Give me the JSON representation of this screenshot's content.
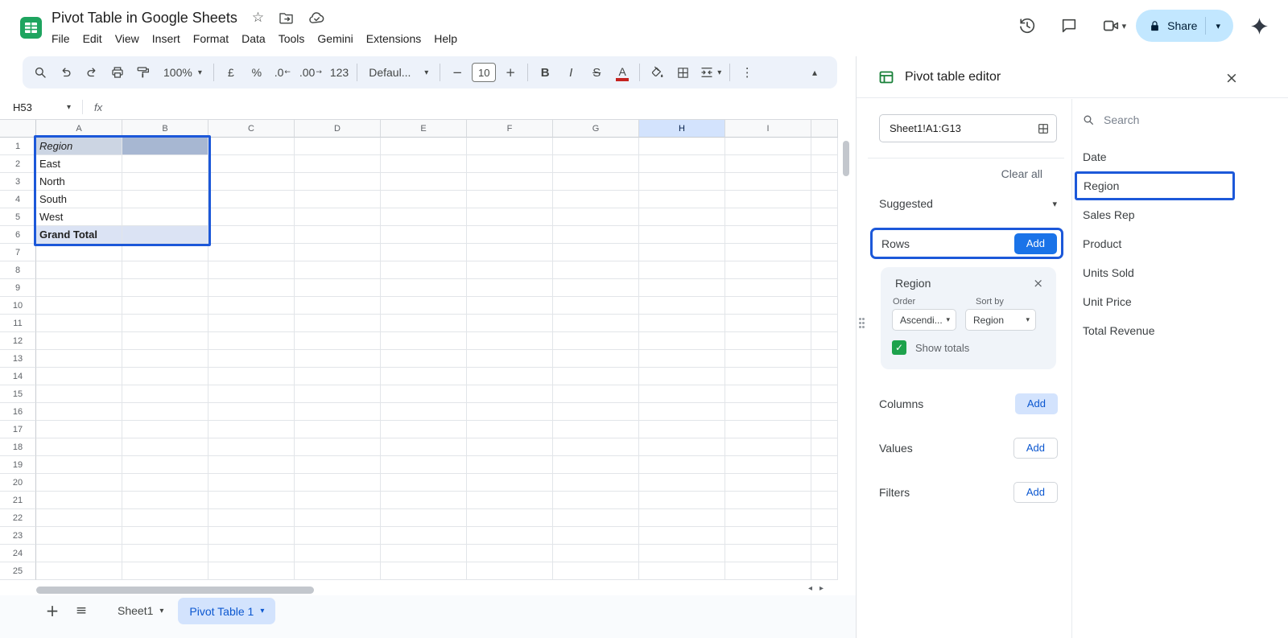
{
  "icons": {
    "star": "☆",
    "caret_down": "▾",
    "caret_up": "▴",
    "more_vertical": "⋮",
    "minus": "−",
    "plus": "+",
    "hamburger": "≡",
    "close": "×",
    "check": "✓",
    "scroll_left": "◂",
    "scroll_right": "▸",
    "arrow_left": "←",
    "arrow_right": "→"
  },
  "header": {
    "doc_title": "Pivot Table in Google Sheets",
    "menus": [
      "File",
      "Edit",
      "View",
      "Insert",
      "Format",
      "Data",
      "Tools",
      "Gemini",
      "Extensions",
      "Help"
    ],
    "share_label": "Share"
  },
  "toolbar": {
    "zoom_value": "100%",
    "currency_label": "£",
    "percent_label": "%",
    "decrease_decimal_label": ".0",
    "increase_decimal_label": ".00",
    "number_format_label": "123",
    "font_family_value": "Defaul...",
    "font_size_value": "10",
    "bold_label": "B",
    "italic_label": "I",
    "strikethrough_label": "S",
    "text_color_label": "A"
  },
  "formula_bar": {
    "cell_reference": "H53",
    "fx_label": "fx"
  },
  "grid": {
    "column_headers": [
      "A",
      "B",
      "C",
      "D",
      "E",
      "F",
      "G",
      "H",
      "I"
    ],
    "highlighted_column": "H",
    "row_numbers": [
      1,
      2,
      3,
      4,
      5,
      6,
      7,
      8,
      9,
      10,
      11,
      12,
      13,
      14,
      15,
      16,
      17,
      18,
      19,
      20,
      21,
      22,
      23,
      24,
      25
    ],
    "cells": {
      "A1": "Region",
      "A2": "East",
      "A3": "North",
      "A4": "South",
      "A5": "West",
      "A6": "Grand Total"
    }
  },
  "pivot_editor": {
    "title": "Pivot table editor",
    "range_value": "Sheet1!A1:G13",
    "clear_all_label": "Clear all",
    "suggested_label": "Suggested",
    "rows_label": "Rows",
    "columns_label": "Columns",
    "values_label": "Values",
    "filters_label": "Filters",
    "add_label": "Add",
    "row_group": {
      "field_name": "Region",
      "order_label": "Order",
      "order_value": "Ascendi...",
      "sort_by_label": "Sort by",
      "sort_by_value": "Region",
      "show_totals_label": "Show totals",
      "show_totals_checked": true
    },
    "search_placeholder": "Search",
    "fields": [
      "Date",
      "Region",
      "Sales Rep",
      "Product",
      "Units Sold",
      "Unit Price",
      "Total Revenue"
    ],
    "selected_field": "Region"
  },
  "bottom_bar": {
    "sheet_tab_label": "Sheet1",
    "active_tab_label": "Pivot Table 1"
  },
  "colors": {
    "accent_blue": "#1a73e8",
    "link_blue": "#0b57d0",
    "highlight_border": "#1c58d9",
    "share_button_bg": "#c2e7ff",
    "active_column_bg": "#d3e3fd",
    "active_tab_bg": "#d3e3fd",
    "checkbox_green": "#1ea24c",
    "logo_green": "#1ea45f",
    "pivot_header_cell_bg": "#a7b7d2",
    "grand_total_row_bg": "#dbe3f4"
  }
}
